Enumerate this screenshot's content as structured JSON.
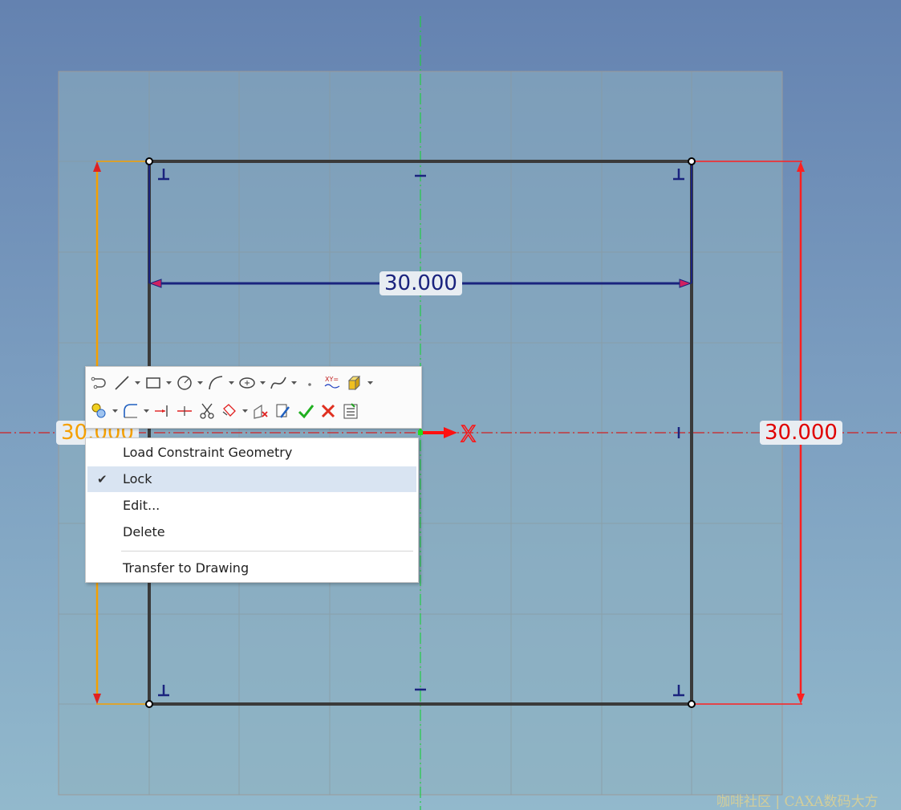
{
  "dimensions": {
    "horizontal": "30.000",
    "vertical": "30.000",
    "offset": "30.000"
  },
  "axis_label": "X",
  "colors": {
    "profile": "#3a3a3a",
    "dim_horizontal": "#1a237e",
    "dim_vertical": "#e00000",
    "dim_offset": "#f5a000",
    "grid_panel": "#8eb1bf",
    "center_axis": "#22cc44"
  },
  "toolbar": {
    "row1": [
      "connect-icon",
      "line-icon",
      "rectangle-icon",
      "circle-icon",
      "arc-icon",
      "ellipse-icon",
      "spline-icon",
      "point-icon",
      "equation-curve-icon",
      "extrude-icon"
    ],
    "row2": [
      "project-icon",
      "fillet-icon",
      "extend-icon",
      "split-icon",
      "trim-icon",
      "offset-icon",
      "delete-plane-icon",
      "edit-icon",
      "finish-icon",
      "cancel-icon",
      "checklist-icon"
    ]
  },
  "context_menu": {
    "items": [
      {
        "label": "Load Constraint Geometry",
        "checked": false
      },
      {
        "label": "Lock",
        "checked": true
      },
      {
        "label": "Edit...",
        "checked": false
      },
      {
        "label": "Delete",
        "checked": false
      },
      {
        "label": "Transfer to Drawing",
        "checked": false
      }
    ],
    "check_glyph": "✔"
  },
  "watermark": "咖啡社区 | CAXA数码大方"
}
